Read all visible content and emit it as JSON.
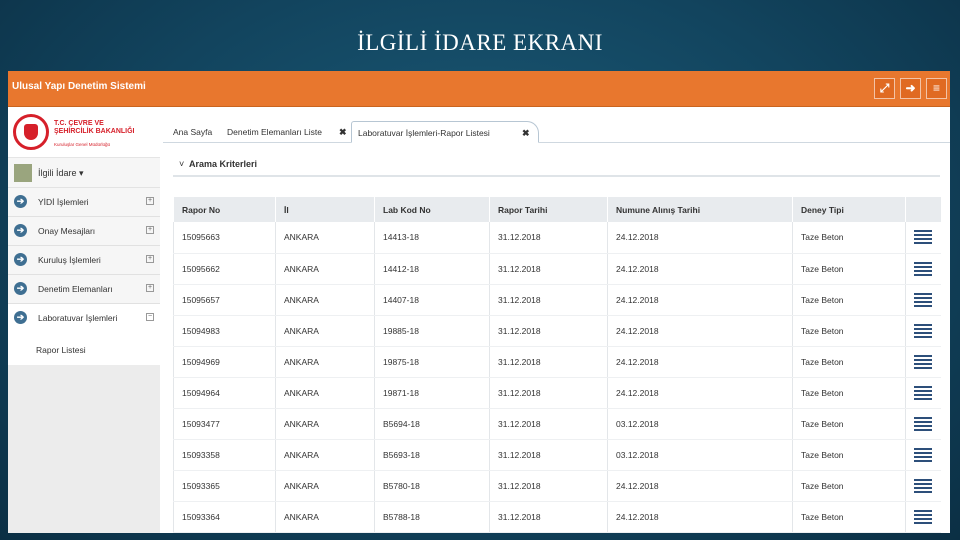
{
  "slide": {
    "title": "İLGİLİ İDARE EKRANI"
  },
  "app": {
    "title": "Ulusal Yapı Denetim Sistemi",
    "topbar_icons": [
      "fullscreen-icon",
      "logout-icon",
      "menu-icon"
    ]
  },
  "sidebar": {
    "org_name_line1": "T.C. ÇEVRE VE",
    "org_name_line2": "ŞEHİRCİLİK BAKANLIĞI",
    "org_sub": "Kuruluşlar Genel Müdürlüğü",
    "user_label": "İlgili İdare ▾",
    "items": [
      {
        "label": "YİDİ İşlemleri",
        "expand": "⊞"
      },
      {
        "label": "Onay Mesajları",
        "expand": "⊞"
      },
      {
        "label": "Kuruluş İşlemleri",
        "expand": "⊞"
      },
      {
        "label": "Denetim Elemanları",
        "expand": "⊞"
      },
      {
        "label": "Laboratuvar İşlemleri",
        "expand": "⊟"
      }
    ],
    "subitems": [
      {
        "label": "Rapor Listesi"
      }
    ]
  },
  "tabs": [
    {
      "label": "Ana Sayfa",
      "active": false
    },
    {
      "label": "Denetim Elemanları Liste",
      "active": false
    },
    {
      "label": "Laboratuvar İşlemleri-Rapor Listesi",
      "active": true
    }
  ],
  "section": {
    "title": "Arama Kriterleri",
    "chevron": "˅"
  },
  "table": {
    "columns": [
      "Rapor No",
      "İl",
      "Lab Kod No",
      "Rapor Tarihi",
      "Numune Alınış Tarihi",
      "Deney Tipi",
      ""
    ],
    "rows": [
      [
        "15095663",
        "ANKARA",
        "14413-18",
        "31.12.2018",
        "24.12.2018",
        "Taze Beton"
      ],
      [
        "15095662",
        "ANKARA",
        "14412-18",
        "31.12.2018",
        "24.12.2018",
        "Taze Beton"
      ],
      [
        "15095657",
        "ANKARA",
        "14407-18",
        "31.12.2018",
        "24.12.2018",
        "Taze Beton"
      ],
      [
        "15094983",
        "ANKARA",
        "19885-18",
        "31.12.2018",
        "24.12.2018",
        "Taze Beton"
      ],
      [
        "15094969",
        "ANKARA",
        "19875-18",
        "31.12.2018",
        "24.12.2018",
        "Taze Beton"
      ],
      [
        "15094964",
        "ANKARA",
        "19871-18",
        "31.12.2018",
        "24.12.2018",
        "Taze Beton"
      ],
      [
        "15093477",
        "ANKARA",
        "B5694-18",
        "31.12.2018",
        "03.12.2018",
        "Taze Beton"
      ],
      [
        "15093358",
        "ANKARA",
        "B5693-18",
        "31.12.2018",
        "03.12.2018",
        "Taze Beton"
      ],
      [
        "15093365",
        "ANKARA",
        "B5780-18",
        "31.12.2018",
        "24.12.2018",
        "Taze Beton"
      ],
      [
        "15093364",
        "ANKARA",
        "B5788-18",
        "31.12.2018",
        "24.12.2018",
        "Taze Beton"
      ]
    ]
  }
}
